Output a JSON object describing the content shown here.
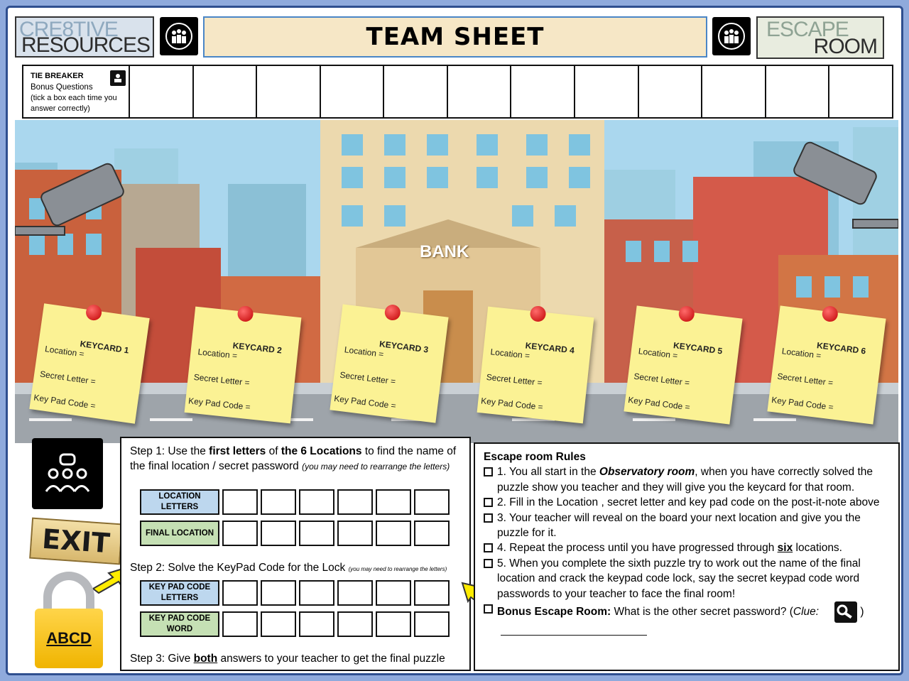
{
  "header": {
    "left_logo_line1": "CRE8TIVE",
    "left_logo_line2": "RESOURCES",
    "title": "TEAM SHEET",
    "right_logo_line1": "ESCAPE",
    "right_logo_line2": "ROOM"
  },
  "tie_breaker": {
    "title": "TIE BREAKER",
    "subtitle": "Bonus Questions",
    "instruction": "(tick  a box each time you answer correctly)",
    "box_count": 12
  },
  "scene": {
    "bank_sign": "BANK",
    "keycards": [
      {
        "title": "KEYCARD 1",
        "location": "Location =",
        "letter": "Secret Letter =",
        "code": "Key Pad Code ="
      },
      {
        "title": "KEYCARD 2",
        "location": "Location =",
        "letter": "Secret Letter =",
        "code": "Key Pad Code ="
      },
      {
        "title": "KEYCARD 3",
        "location": "Location =",
        "letter": "Secret Letter =",
        "code": "Key Pad Code ="
      },
      {
        "title": "KEYCARD 4",
        "location": "Location =",
        "letter": "Secret Letter =",
        "code": "Key Pad Code ="
      },
      {
        "title": "KEYCARD 5",
        "location": "Location =",
        "letter": "Secret Letter =",
        "code": "Key Pad Code ="
      },
      {
        "title": "KEYCARD 6",
        "location": "Location =",
        "letter": "Secret Letter =",
        "code": "Key Pad Code ="
      }
    ]
  },
  "side": {
    "exit_sign": "EXIT",
    "lock_code": "ABCD"
  },
  "steps": {
    "step1_a": "Step 1: Use the ",
    "step1_b": "first letters",
    "step1_c": " of ",
    "step1_d": "the 6 Locations",
    "step1_e": " to find the  name of the final location / secret password ",
    "step1_note": "(you may need to rearrange the letters)",
    "row_location_letters": "LOCATION LETTERS",
    "row_final_location": "FINAL LOCATION",
    "step2": "Step 2: Solve the KeyPad Code for the Lock ",
    "step2_note": "(you may need to rearrange the letters)",
    "row_keypad_letters": "KEY PAD CODE LETTERS",
    "row_keypad_word": "KEY PAD CODE WORD",
    "step3_a": "Step 3: Give ",
    "step3_b": "both",
    "step3_c": " answers to your teacher to get the final puzzle"
  },
  "rules": {
    "title": "Escape room Rules",
    "r1_a": "1. You all start in the ",
    "r1_b": "Observatory room",
    "r1_c": ", when you have correctly solved the puzzle show you teacher and they will give you the keycard for that room.",
    "r2": "2. Fill in the Location , secret letter and key pad code on the post-it-note above",
    "r3": "3. Your teacher will reveal on the board your next location and give you the puzzle for it.",
    "r4_a": "4. Repeat the process until you have progressed through ",
    "r4_b": "six",
    "r4_c": " locations.",
    "r5": "5. When you complete the sixth puzzle try to work out the name of the final location and crack the keypad code lock, say the secret keypad code word passwords to your teacher to face the final room!",
    "bonus_a": "Bonus Escape Room:",
    "bonus_b": " What is the other secret password? (",
    "bonus_clue": "Clue:",
    "bonus_end": ")"
  },
  "colors": {
    "location_blue": "#bdd7ee",
    "final_green": "#c5e0b4",
    "postit_yellow": "#fbf294",
    "title_cream": "#f6e7c6"
  }
}
